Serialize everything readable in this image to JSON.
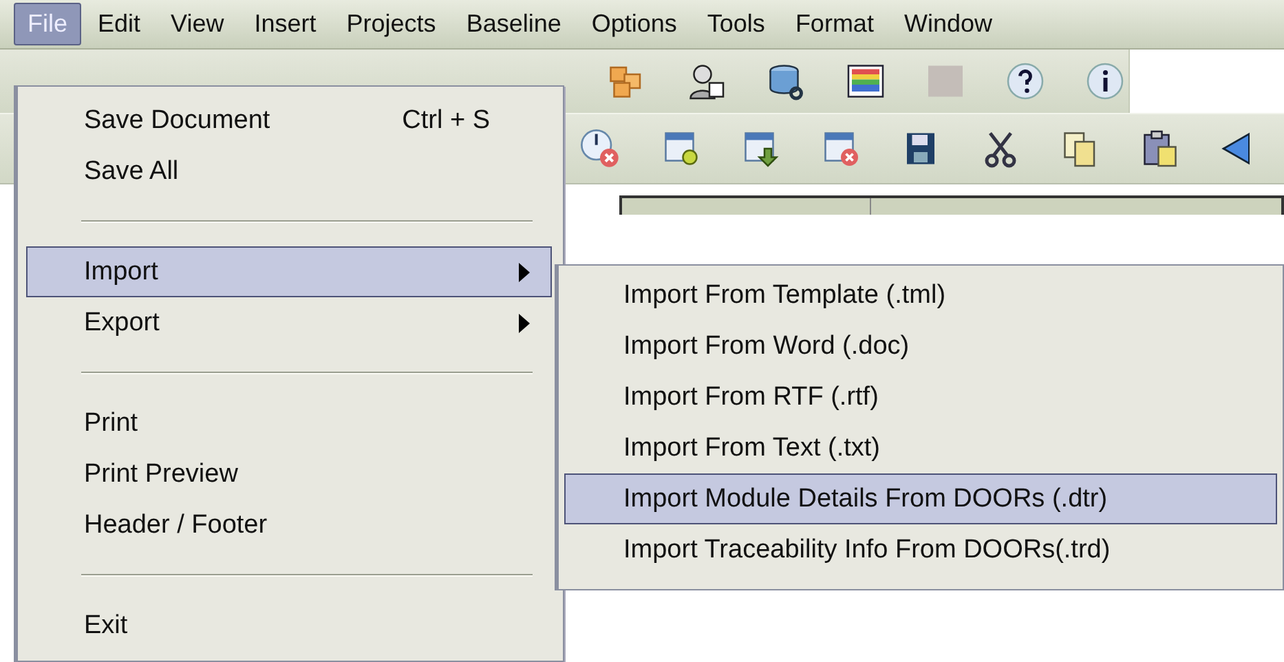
{
  "menubar": [
    {
      "label": "File",
      "selected": true
    },
    {
      "label": "Edit",
      "selected": false
    },
    {
      "label": "View",
      "selected": false
    },
    {
      "label": "Insert",
      "selected": false
    },
    {
      "label": "Projects",
      "selected": false
    },
    {
      "label": "Baseline",
      "selected": false
    },
    {
      "label": "Options",
      "selected": false
    },
    {
      "label": "Tools",
      "selected": false
    },
    {
      "label": "Format",
      "selected": false
    },
    {
      "label": "Window",
      "selected": false
    }
  ],
  "file_menu": [
    {
      "kind": "item",
      "label": "Save Document",
      "shortcut": "Ctrl + S",
      "selected": false
    },
    {
      "kind": "item",
      "label": "Save All",
      "selected": false
    },
    {
      "kind": "separator"
    },
    {
      "kind": "submenu",
      "label": "Import",
      "selected": true
    },
    {
      "kind": "submenu",
      "label": "Export",
      "selected": false
    },
    {
      "kind": "separator"
    },
    {
      "kind": "item",
      "label": "Print",
      "selected": false
    },
    {
      "kind": "item",
      "label": "Print Preview",
      "selected": false
    },
    {
      "kind": "item",
      "label": "Header / Footer",
      "selected": false
    },
    {
      "kind": "separator"
    },
    {
      "kind": "item",
      "label": "Exit",
      "selected": false
    }
  ],
  "import_submenu": [
    {
      "label": "Import From Template (.tml)",
      "selected": false
    },
    {
      "label": "Import From Word (.doc)",
      "selected": false
    },
    {
      "label": "Import From RTF (.rtf)",
      "selected": false
    },
    {
      "label": "Import From Text (.txt)",
      "selected": false
    },
    {
      "label": "Import Module Details From DOORs (.dtr)",
      "selected": true
    },
    {
      "label": "Import Traceability Info From DOORs(.trd)",
      "selected": false
    }
  ]
}
